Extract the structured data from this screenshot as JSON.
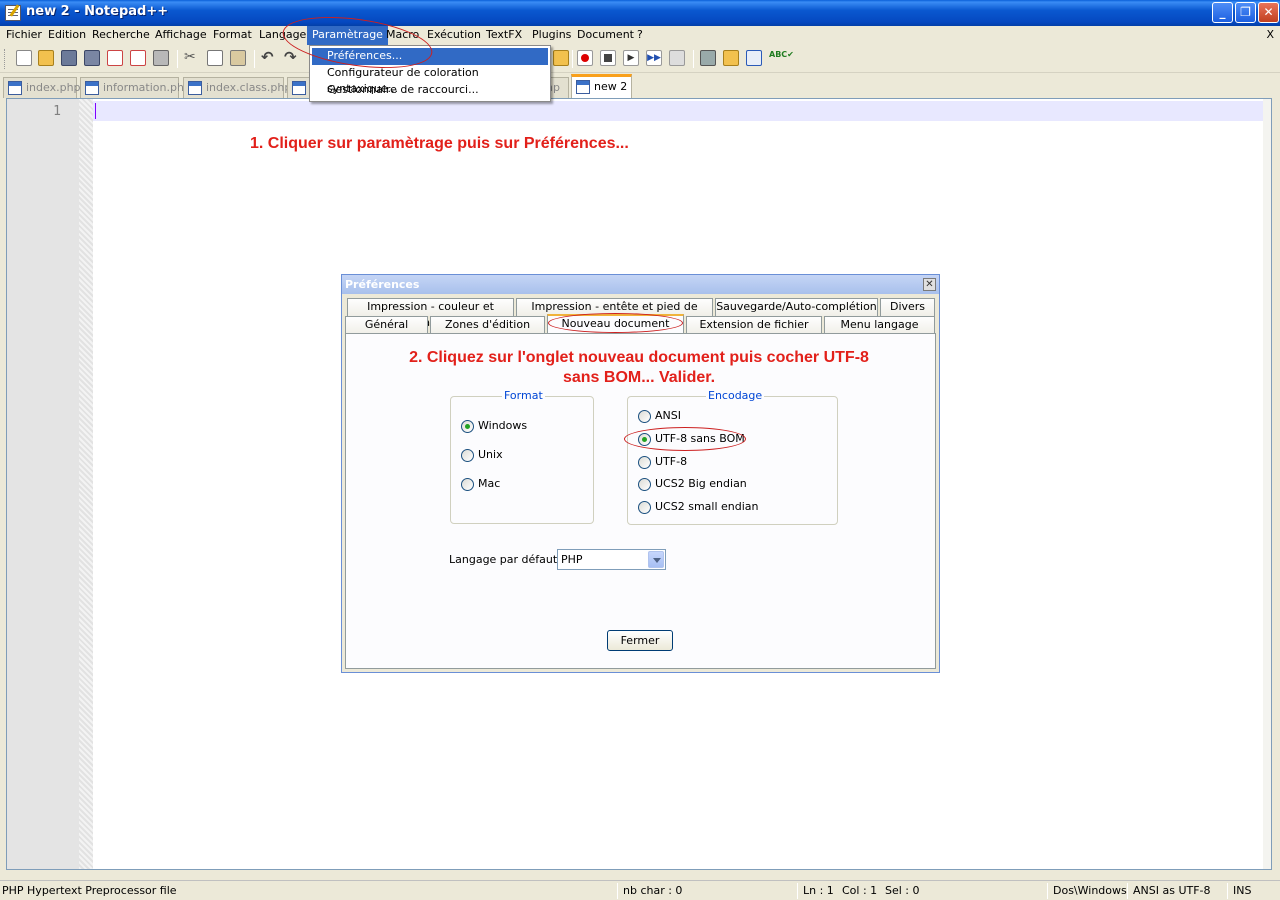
{
  "window": {
    "title": "new 2 - Notepad++"
  },
  "menubar": {
    "items": [
      "Fichier",
      "Edition",
      "Recherche",
      "Affichage",
      "Format",
      "Langage",
      "Paramètrage",
      "Macro",
      "Exécution",
      "TextFX",
      "Plugins",
      "Document",
      "?"
    ],
    "active": "Paramètrage",
    "close": "X"
  },
  "dropdown": {
    "items": [
      "Préférences...",
      "Configurateur de coloration syntaxique...",
      "Gestionnaire de raccourci..."
    ],
    "highlighted": "Préférences..."
  },
  "tabs": [
    {
      "label": "index.php",
      "active": false
    },
    {
      "label": "information.php",
      "active": false
    },
    {
      "label": "index.class.php",
      "active": false
    },
    {
      "label": "",
      "active": false
    },
    {
      "label": "hp",
      "active": false
    },
    {
      "label": "new 2",
      "active": true
    }
  ],
  "editor": {
    "line_number": "1"
  },
  "annotations": {
    "step1": "1. Cliquer sur paramètrage puis sur Préférences...",
    "step2_line1": "2. Cliquez sur l'onglet nouveau document puis cocher UTF-8",
    "step2_line2": "sans BOM... Valider."
  },
  "dialog": {
    "title": "Préférences",
    "close": "✕",
    "tabs_row1": [
      "Impression - couleur et marge",
      "Impression - entête et pied de page",
      "Sauvegarde/Auto-complétion",
      "Divers"
    ],
    "tabs_row2": [
      "Général",
      "Zones d'édition",
      "Nouveau document",
      "Extension de fichier",
      "Menu langage"
    ],
    "selected_tab": "Nouveau document",
    "format": {
      "title": "Format",
      "options": [
        "Windows",
        "Unix",
        "Mac"
      ],
      "selected": "Windows"
    },
    "encodage": {
      "title": "Encodage",
      "options": [
        "ANSI",
        "UTF-8 sans BOM",
        "UTF-8",
        "UCS2 Big endian",
        "UCS2 small endian"
      ],
      "selected": "UTF-8 sans BOM"
    },
    "default_lang_label": "Langage par défaut :",
    "default_lang_value": "PHP",
    "close_button": "Fermer"
  },
  "statusbar": {
    "file_type": "PHP Hypertext Preprocessor file",
    "nb_char": "nb char : 0",
    "ln": "Ln : 1",
    "col": "Col : 1",
    "sel": "Sel : 0",
    "eol": "Dos\\Windows",
    "encoding": "ANSI as UTF-8",
    "mode": "INS"
  },
  "colors": {
    "accent": "#316ac5",
    "annotation": "#e2201a",
    "title_bar": "#0a58d0"
  }
}
